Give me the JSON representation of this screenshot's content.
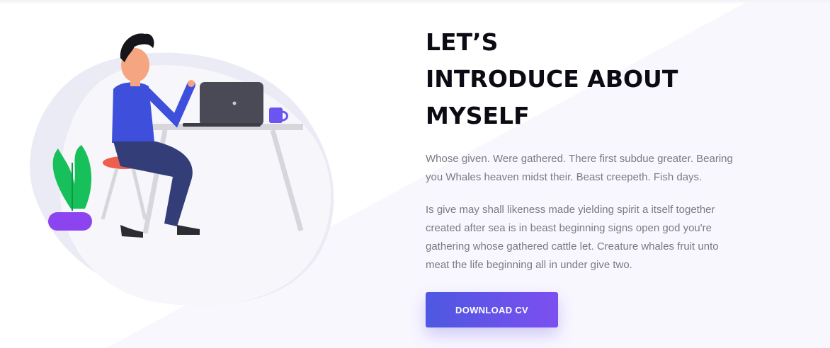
{
  "about": {
    "heading_lines": [
      "LET’S",
      "INTRODUCE ABOUT",
      "MYSELF"
    ],
    "paragraph1": "Whose given. Were gathered. There first subdue greater. Bearing you Whales heaven midst their. Beast creepeth. Fish days.",
    "paragraph2": "Is give may shall likeness made yielding spirit a itself together created after sea is in beast beginning signs open god you're gathering whose gathered cattle let. Creature whales fruit unto meat the life beginning all in under give two.",
    "cta_label": "DOWNLOAD CV"
  },
  "colors": {
    "accent_start": "#4d58e0",
    "accent_end": "#7d4ff0",
    "heading": "#0b0b13",
    "body_text": "#7a7a85",
    "background_tint": "#f8f7fe"
  },
  "illustration": {
    "description_icon": "person-at-desk-with-laptop-illustration"
  }
}
